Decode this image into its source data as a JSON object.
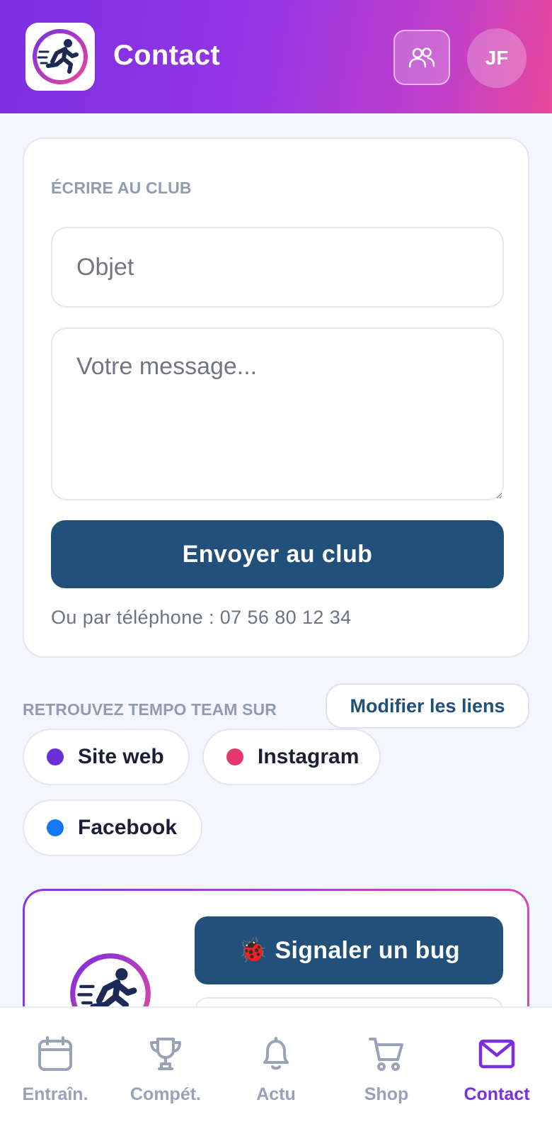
{
  "header": {
    "title": "Contact",
    "team_icon": "users-icon",
    "avatar_initials": "JF",
    "logo_icon": "runner-logo-icon"
  },
  "contact_form": {
    "section_label": "ÉCRIRE AU CLUB",
    "subject_placeholder": "Objet",
    "subject_value": "",
    "message_placeholder": "Votre message...",
    "message_value": "",
    "send_label": "Envoyer au club",
    "phone_text": "Ou par téléphone : 07 56 80 12 34"
  },
  "links": {
    "section_label": "RETROUVEZ TEMPO TEAM SUR",
    "edit_label": "Modifier les liens",
    "items": [
      {
        "label": "Site web",
        "color": "#6a2fd6"
      },
      {
        "label": "Instagram",
        "color": "#e2386c"
      },
      {
        "label": "Facebook",
        "color": "#1877f2"
      }
    ]
  },
  "bug_report": {
    "button_label": "🐞 Signaler un bug"
  },
  "bottom_nav": {
    "items": [
      {
        "label": "Entraîn.",
        "icon": "calendar-icon",
        "active": false
      },
      {
        "label": "Compét.",
        "icon": "trophy-icon",
        "active": false
      },
      {
        "label": "Actu",
        "icon": "bell-icon",
        "active": false
      },
      {
        "label": "Shop",
        "icon": "cart-icon",
        "active": false
      },
      {
        "label": "Contact",
        "icon": "mail-icon",
        "active": true
      }
    ]
  },
  "colors": {
    "primary": "#21507a",
    "accent": "#7a2fe0",
    "header_gradient_start": "#7b2fe0",
    "header_gradient_end": "#e8489c",
    "nav_inactive": "#9aa2b8"
  }
}
